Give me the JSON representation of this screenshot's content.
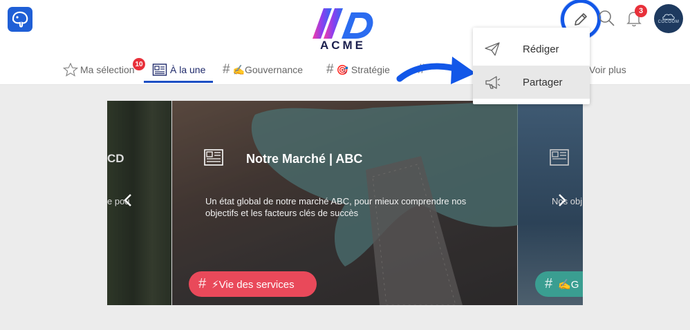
{
  "header": {
    "brand_name": "ACME",
    "notification_count": "3",
    "avatar_label": "COCOOM"
  },
  "tabs": [
    {
      "label": "Ma sélection",
      "badge": "10"
    },
    {
      "label": "À la une"
    },
    {
      "label": "✍️Gouvernance"
    },
    {
      "label": "🎯 Stratégie"
    },
    {
      "label": "Voir plus"
    }
  ],
  "dropdown": {
    "items": [
      {
        "label": "Rédiger",
        "icon": "paper-plane-icon"
      },
      {
        "label": "Partager",
        "icon": "megaphone-icon"
      }
    ]
  },
  "carousel": {
    "left_fragment_title": "CD",
    "left_fragment_text": "e pou",
    "main": {
      "title": "Notre Marché | ABC",
      "description": "Un état global de notre marché ABC, pour mieux comprendre nos objectifs et les facteurs clés de succès",
      "tag": "⚡Vie des services",
      "tag_color": "#e9495a"
    },
    "right_fragment_text": "Nos obj",
    "right_fragment_tag": "✍️G",
    "right_tag_color": "#3a9e91"
  },
  "colors": {
    "accent": "#1257e8",
    "badge": "#e8303a",
    "active_tab": "#1d4fc4"
  }
}
